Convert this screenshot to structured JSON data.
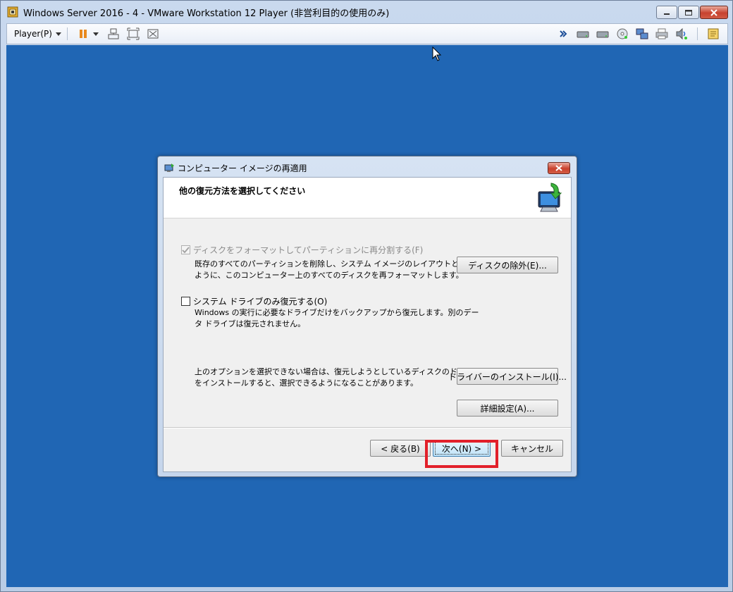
{
  "window": {
    "title": "Windows Server 2016 - 4 - VMware Workstation 12 Player (非営利目的の使用のみ)"
  },
  "toolbar": {
    "player_menu": "Player(P)",
    "icons_left": [
      "pause-icon",
      "send-ctrl-alt-del-icon",
      "fullscreen-icon",
      "unity-icon"
    ],
    "icons_right": [
      "more-icon",
      "hard-disk-icon",
      "hard-disk-2-icon",
      "cd-dvd-icon",
      "network-icon",
      "printer-icon",
      "sound-icon",
      "message-log-icon"
    ]
  },
  "dialog": {
    "title": "コンピューター イメージの再適用",
    "heading": "他の復元方法を選択してください",
    "option_format": {
      "label": "ディスクをフォーマットしてパーティションに再分割する(F)",
      "checked": true,
      "disabled": true,
      "description_line1": "既存のすべてのパーティションを削除し、システム イメージのレイアウトと一致する",
      "description_line2": "ように、このコンピューター上のすべてのディスクを再フォーマットします。"
    },
    "exclude_disks_button": "ディスクの除外(E)...",
    "option_system_drive": {
      "label": "システム ドライブのみ復元する(O)",
      "checked": false,
      "description_line1": "Windows の実行に必要なドライブだけをバックアップから復元します。別のデー",
      "description_line2": "タ ドライブは復元されません。"
    },
    "driver_note_line1": "上のオプションを選択できない場合は、復元しようとしているディスクのドライバー",
    "driver_note_line2": "をインストールすると、選択できるようになることがあります。",
    "install_driver_button": "ドライバーのインストール(I)...",
    "advanced_button": "詳細設定(A)...",
    "back_button": "< 戻る(B)",
    "next_button": "次へ(N) >",
    "cancel_button": "キャンセル"
  },
  "colors": {
    "vm_background": "#2066b4",
    "highlight": "#e2202a"
  }
}
